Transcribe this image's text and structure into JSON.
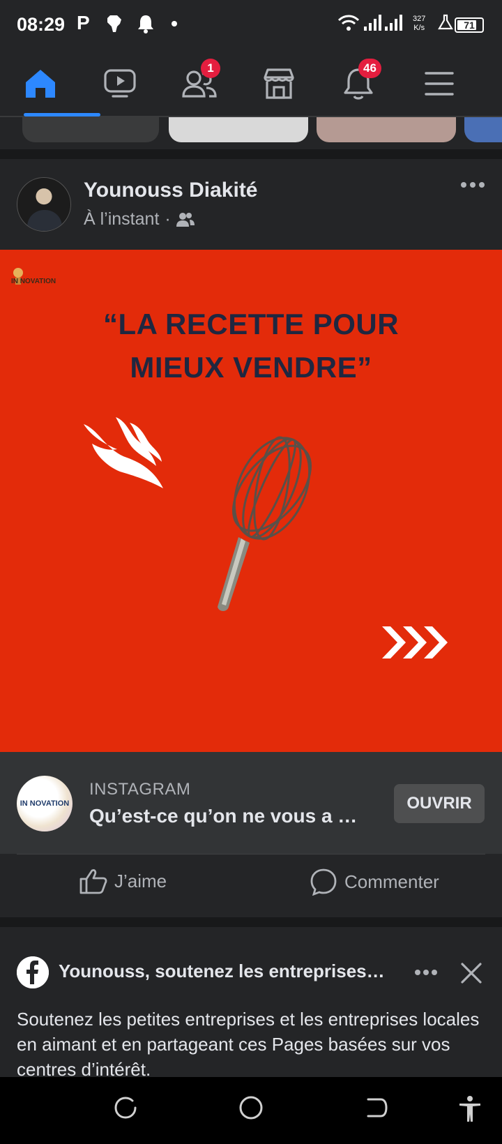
{
  "status_bar": {
    "time": "08:29",
    "carrier_icon": "P",
    "net_speed_value": "327",
    "net_speed_unit": "K/s",
    "battery": "71",
    "icons": [
      "africa-icon",
      "bell-icon",
      "dot-icon",
      "wifi-icon",
      "signal-icon",
      "signal-icon",
      "flask-icon",
      "battery-icon"
    ]
  },
  "nav": {
    "tabs": [
      {
        "name": "home",
        "icon": "home-icon",
        "active": true
      },
      {
        "name": "watch",
        "icon": "video-icon"
      },
      {
        "name": "friends",
        "icon": "friends-icon",
        "badge": "1"
      },
      {
        "name": "marketplace",
        "icon": "store-icon"
      },
      {
        "name": "notifications",
        "icon": "bell-icon",
        "badge": "46"
      },
      {
        "name": "menu",
        "icon": "menu-icon"
      }
    ],
    "accent": "#2d88ff",
    "badge_color": "#e41e3f"
  },
  "post": {
    "author": "Younouss Diakité",
    "time": "À l’instant",
    "separator": "·",
    "audience_icon": "friends-icon",
    "image": {
      "background": "#e32b0a",
      "logo": "IN NOVATION",
      "headline_line1": "“LA RECETTE POUR",
      "headline_line2": "MIEUX VENDRE”"
    },
    "link": {
      "source": "INSTAGRAM",
      "title": "Qu’est-ce qu’on ne vous a pa…",
      "logo_text": "IN NOVATION",
      "button": "OUVRIR"
    },
    "actions": {
      "like": "J’aime",
      "comment": "Commenter"
    }
  },
  "suggestion": {
    "title": "Younouss, soutenez les entreprises…",
    "text": "Soutenez les petites entreprises et les entreprises locales en aimant et en partageant ces Pages basées sur vos centres d’intérêt."
  },
  "system_nav": {
    "icons": [
      "recent-apps-icon",
      "home-circle-icon",
      "back-icon",
      "accessibility-icon"
    ]
  }
}
